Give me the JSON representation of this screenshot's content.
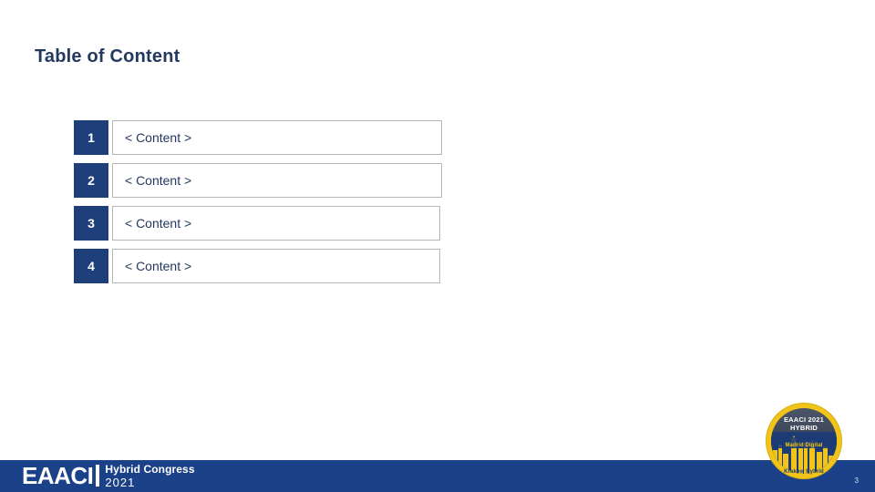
{
  "slide": {
    "title": "Table of Content",
    "page_number": "3",
    "title_color": "#23395f",
    "accent_color": "#1f3f7a",
    "footer_color": "#1b4189",
    "badge_ring_color": "#f0c419"
  },
  "toc": {
    "rows": [
      {
        "number": "1",
        "text": "<  Content  >"
      },
      {
        "number": "2",
        "text": "<  Content  >"
      },
      {
        "number": "3",
        "text": "<  Content  >"
      },
      {
        "number": "4",
        "text": "<  Content  >"
      }
    ]
  },
  "footer": {
    "logo_main": "EAACI",
    "logo_congress": "Hybrid Congress",
    "logo_year": "2021"
  },
  "badge": {
    "title": "EAACI 2021",
    "subtitle": "HYBRID",
    "madrid_label": "Madrid Digital",
    "krakow_label": "Krakow Hybrid"
  }
}
